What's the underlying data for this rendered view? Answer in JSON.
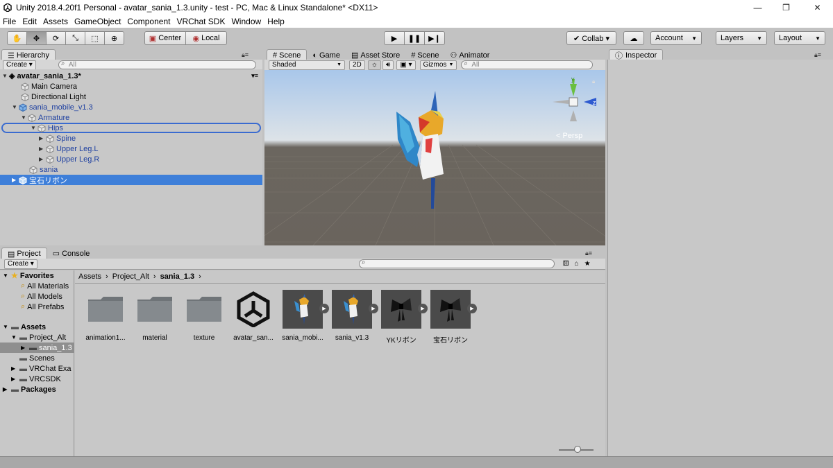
{
  "window": {
    "title": "Unity 2018.4.20f1 Personal - avatar_sania_1.3.unity - test - PC, Mac & Linux Standalone* <DX11>",
    "controls": [
      "—",
      "❐",
      "✕"
    ]
  },
  "menu": [
    "File",
    "Edit",
    "Assets",
    "GameObject",
    "Component",
    "VRChat SDK",
    "Window",
    "Help"
  ],
  "toolbar": {
    "pivot_label": "Center",
    "space_label": "Local",
    "collab_label": "Collab ▾",
    "account_label": "Account",
    "layers_label": "Layers",
    "layout_label": "Layout",
    "tool_icons": [
      "hand-tool-icon",
      "move-tool-icon",
      "rotate-tool-icon",
      "scale-tool-icon",
      "rect-tool-icon",
      "transform-tool-icon"
    ]
  },
  "hierarchy": {
    "tab_label": "Hierarchy",
    "create_label": "Create ▾",
    "search_placeholder": "All",
    "scene_name": "avatar_sania_1.3*",
    "items": [
      {
        "label": "Main Camera"
      },
      {
        "label": "Directional Light"
      },
      {
        "label": "sania_mobile_v1.3"
      },
      {
        "label": "Armature"
      },
      {
        "label": "Hips"
      },
      {
        "label": "Spine"
      },
      {
        "label": "Upper Leg.L"
      },
      {
        "label": "Upper Leg.R"
      },
      {
        "label": "sania"
      },
      {
        "label": "宝石リボン"
      }
    ]
  },
  "scene_tabs": [
    "Scene",
    "Game",
    "Asset Store",
    "Scene",
    "Animator"
  ],
  "scene_bar": {
    "shading": "Shaded",
    "mode_2d": "2D",
    "gizmos": "Gizmos",
    "search_placeholder": "All",
    "persp_label": "< Persp",
    "axis_y": "y",
    "axis_z": "z"
  },
  "inspector": {
    "tab_label": "Inspector"
  },
  "project": {
    "tabs": [
      "Project",
      "Console"
    ],
    "create_label": "Create ▾",
    "breadcrumb": [
      "Assets",
      "Project_Alt",
      "sania_1.3"
    ],
    "favorites_label": "Favorites",
    "favorites": [
      "All Materials",
      "All Models",
      "All Prefabs"
    ],
    "assets_label": "Assets",
    "tree": [
      "Project_Alt",
      "sania_1.3",
      "Scenes",
      "VRChat Exa",
      "VRCSDK"
    ],
    "packages_label": "Packages",
    "files": [
      {
        "label": "animation1...",
        "kind": "folder"
      },
      {
        "label": "material",
        "kind": "folder"
      },
      {
        "label": "texture",
        "kind": "folder"
      },
      {
        "label": "avatar_san...",
        "kind": "unity"
      },
      {
        "label": "sania_mobi...",
        "kind": "model"
      },
      {
        "label": "sania_v1.3",
        "kind": "model"
      },
      {
        "label": "YKリボン",
        "kind": "ribbon"
      },
      {
        "label": "宝石リボン",
        "kind": "ribbon"
      }
    ]
  },
  "colors": {
    "selection": "#3e7fd9",
    "panel_bg": "#c2c2c2",
    "tab_active": "#e0e0e0"
  }
}
